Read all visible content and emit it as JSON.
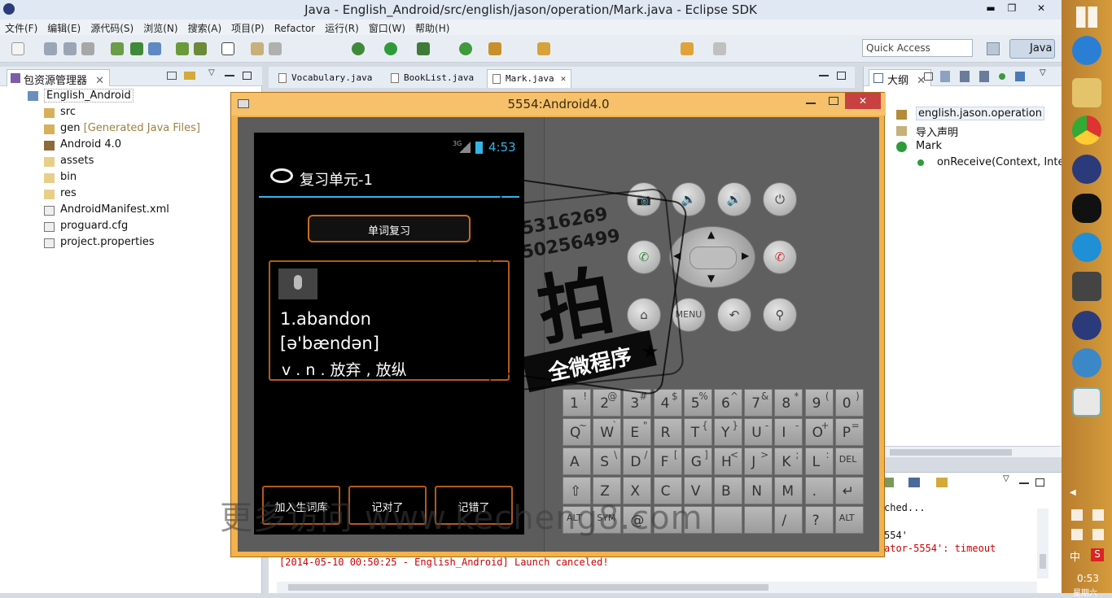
{
  "window": {
    "title": "Java - English_Android/src/english/jason/operation/Mark.java - Eclipse SDK",
    "min": "▬",
    "max": "❐",
    "close": "✕"
  },
  "menu": [
    "文件(F)",
    "编辑(E)",
    "源代码(S)",
    "浏览(N)",
    "搜索(A)",
    "项目(P)",
    "Refactor",
    "运行(R)",
    "窗口(W)",
    "帮助(H)"
  ],
  "toolbar": {
    "quick_access": "Quick Access",
    "perspective": "Java"
  },
  "package_explorer": {
    "tab_label": "包资源管理器",
    "project": "English_Android",
    "items": [
      {
        "label": "src",
        "extra": ""
      },
      {
        "label": "gen",
        "extra": "[Generated Java Files]"
      },
      {
        "label": "Android 4.0",
        "extra": ""
      },
      {
        "label": "assets",
        "extra": ""
      },
      {
        "label": "bin",
        "extra": ""
      },
      {
        "label": "res",
        "extra": ""
      },
      {
        "label": "AndroidManifest.xml",
        "extra": ""
      },
      {
        "label": "proguard.cfg",
        "extra": ""
      },
      {
        "label": "project.properties",
        "extra": ""
      }
    ]
  },
  "editor_tabs": [
    "Vocabulary.java",
    "BookList.java",
    "Mark.java"
  ],
  "outline": {
    "tab_label": "大纲",
    "items": [
      "english.jason.operation",
      "导入声明",
      "Mark",
      "onReceive(Context, Inten"
    ]
  },
  "console": {
    "lines": [
      "ched...",
      "554'",
      "ator-5554': timeout"
    ],
    "last_line": "[2014-05-10 00:50:25 - English_Android] Launch canceled!"
  },
  "emulator": {
    "title": "5554:Android4.0",
    "status": {
      "network": "3G",
      "time": "4:53"
    },
    "app_title": "复习单元-1",
    "word_review_button": "单词复习",
    "word": "1.abandon",
    "phonetic": "[ə'bændən]",
    "meaning": "v . n . 放弃 , 放纵",
    "buttons": [
      "加入生词库",
      "记对了",
      "记错了"
    ]
  },
  "keyboard": {
    "row1": [
      [
        "1",
        "!"
      ],
      [
        "2",
        "@"
      ],
      [
        "3",
        "#"
      ],
      [
        "4",
        "$"
      ],
      [
        "5",
        "%"
      ],
      [
        "6",
        "^"
      ],
      [
        "7",
        "&"
      ],
      [
        "8",
        "*"
      ],
      [
        "9",
        "("
      ],
      [
        "0",
        ")"
      ]
    ],
    "row2": [
      [
        "Q",
        "~"
      ],
      [
        "W",
        "`"
      ],
      [
        "E",
        "\""
      ],
      [
        "R",
        ""
      ],
      [
        "T",
        "{"
      ],
      [
        "Y",
        "}"
      ],
      [
        "U",
        "-"
      ],
      [
        "I",
        "-"
      ],
      [
        "O",
        "+"
      ],
      [
        "P",
        "="
      ]
    ],
    "row3": [
      [
        "A",
        ""
      ],
      [
        "S",
        "\\"
      ],
      [
        "D",
        "/"
      ],
      [
        "F",
        "["
      ],
      [
        "G",
        "]"
      ],
      [
        "H",
        "<"
      ],
      [
        "J",
        ">"
      ],
      [
        "K",
        ";"
      ],
      [
        "L",
        ":"
      ],
      [
        "DEL",
        ""
      ]
    ],
    "row4": [
      [
        "⇧",
        ""
      ],
      [
        "Z",
        ""
      ],
      [
        "X",
        ""
      ],
      [
        "C",
        ""
      ],
      [
        "V",
        ""
      ],
      [
        "B",
        ""
      ],
      [
        "N",
        ""
      ],
      [
        "M",
        ""
      ],
      [
        ".",
        ""
      ],
      [
        "↵",
        ""
      ]
    ],
    "row5": [
      [
        "ALT",
        ""
      ],
      [
        "SYM",
        ""
      ],
      [
        "@",
        ""
      ],
      [
        "",
        ""
      ],
      [
        "",
        ""
      ],
      [
        "",
        ""
      ],
      [
        "",
        ""
      ],
      [
        "/",
        ""
      ],
      [
        "?",
        ""
      ],
      [
        "ALT",
        ""
      ]
    ]
  },
  "controls": {
    "menu": "MENU"
  },
  "watermark": {
    "phone1": "5316269",
    "phone2": "50256499",
    "big": "拍",
    "stamp": "全微程序",
    "url": "更多访问 www.kecheng8.com"
  },
  "taskbar": {
    "time": "0:53",
    "date": "星期六"
  }
}
